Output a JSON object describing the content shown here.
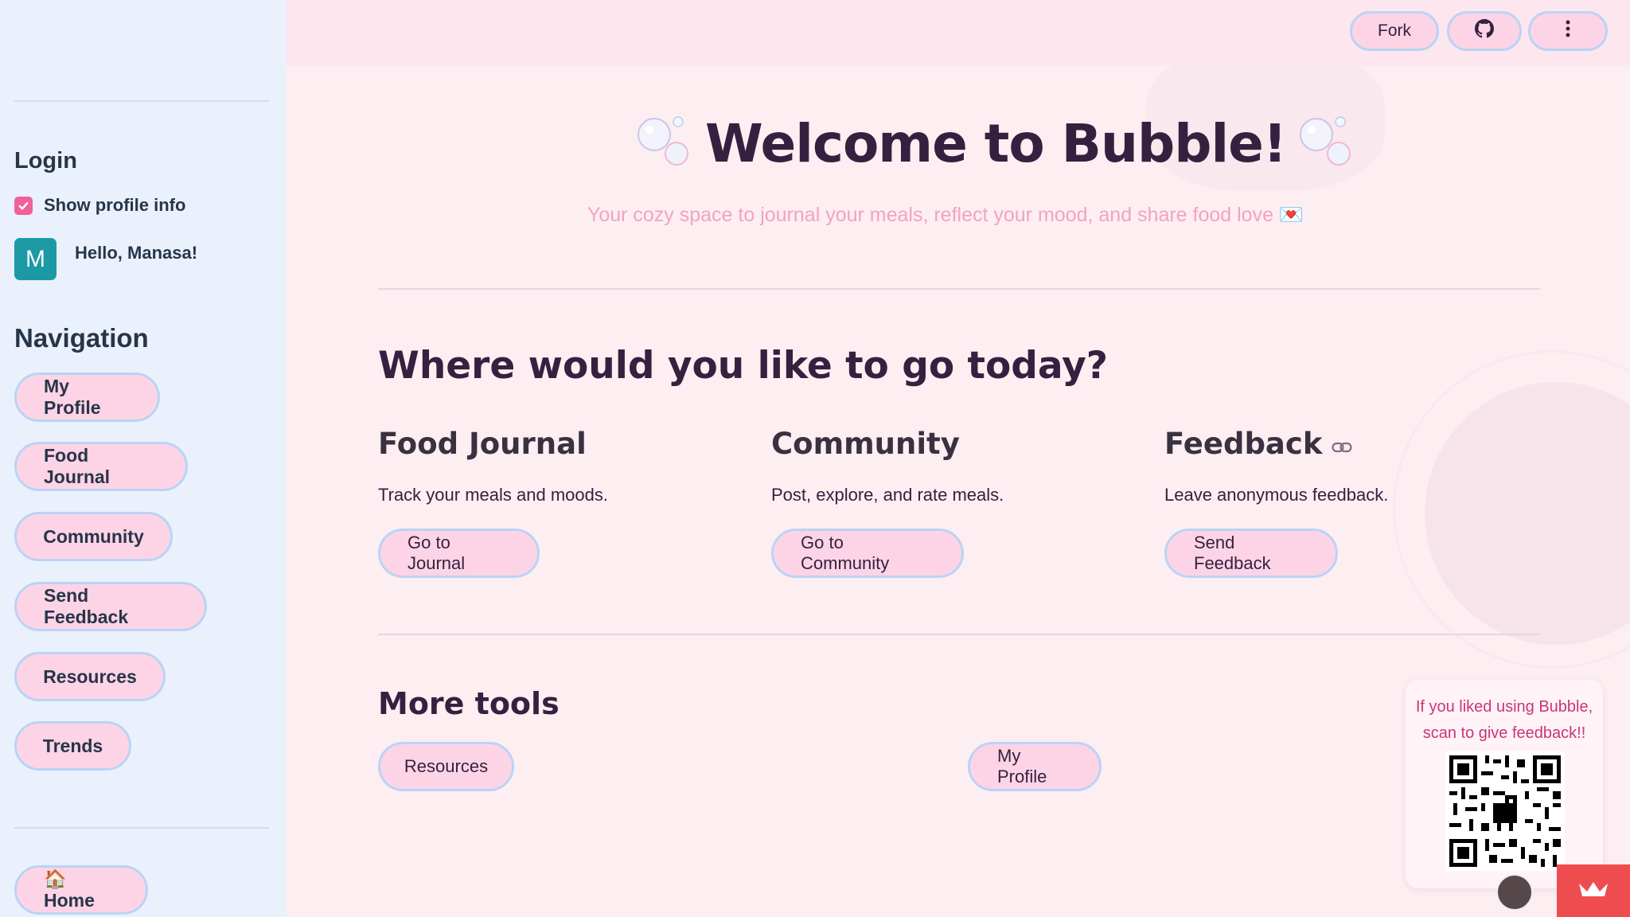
{
  "sidebar": {
    "login_heading": "Login",
    "show_profile_label": "Show profile info",
    "avatar_initial": "M",
    "greeting": "Hello, Manasa!",
    "nav_heading": "Navigation",
    "nav_items": [
      "My Profile",
      "Food Journal",
      "Community",
      "Send Feedback",
      "Resources",
      "Trends"
    ],
    "home_label": "🏠 Home"
  },
  "toolbar": {
    "fork_label": "Fork"
  },
  "hero": {
    "title": "Welcome to Bubble!",
    "subtitle": "Your cozy space to journal your meals, reflect your mood, and share food love 💌"
  },
  "destinations": {
    "heading": "Where would you like to go today?",
    "cards": [
      {
        "title": "Food Journal",
        "desc": "Track your meals and moods.",
        "button": "Go to Journal"
      },
      {
        "title": "Community",
        "desc": "Post, explore, and rate meals.",
        "button": "Go to Community"
      },
      {
        "title": "Feedback",
        "desc": "Leave anonymous feedback.",
        "button": "Send Feedback"
      }
    ]
  },
  "more_tools": {
    "heading": "More tools",
    "buttons": [
      "Resources",
      "My Profile"
    ]
  },
  "qr": {
    "line1": "If you liked using Bubble,",
    "line2": "scan to give feedback!!"
  },
  "colors": {
    "accent_pink": "#fdd4e6",
    "button_border": "#b9d4f6",
    "sidebar_bg": "#eaf1fd",
    "checkbox": "#f0609a",
    "avatar": "#1b9aa6"
  }
}
